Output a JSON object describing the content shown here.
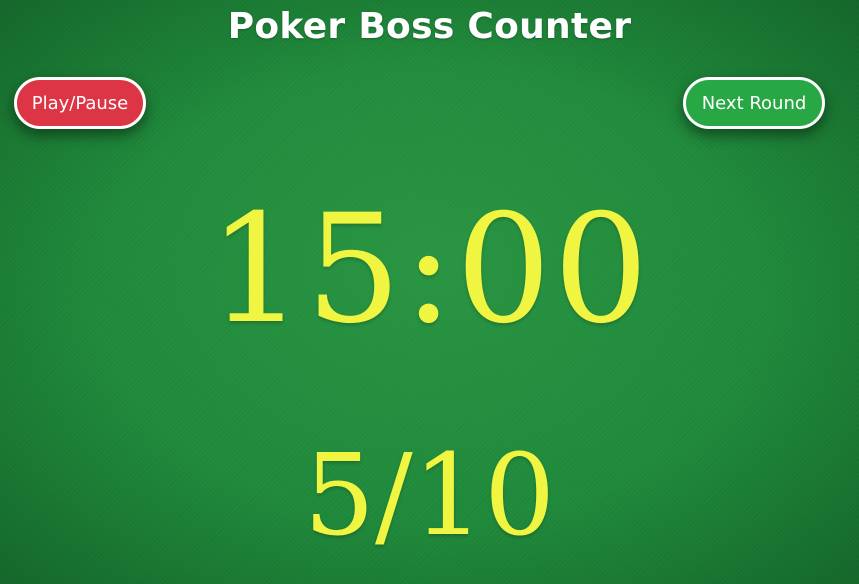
{
  "header": {
    "title": "Poker Boss Counter"
  },
  "controls": {
    "play_pause_label": "Play/Pause",
    "next_round_label": "Next Round"
  },
  "timer": {
    "display": "15:00"
  },
  "round": {
    "display": "5/10"
  },
  "colors": {
    "background_felt": "#1f8a3b",
    "play_pause_button": "#dc3545",
    "next_round_button": "#28a745",
    "counter_text": "#f0f542",
    "title_text": "#ffffff"
  }
}
